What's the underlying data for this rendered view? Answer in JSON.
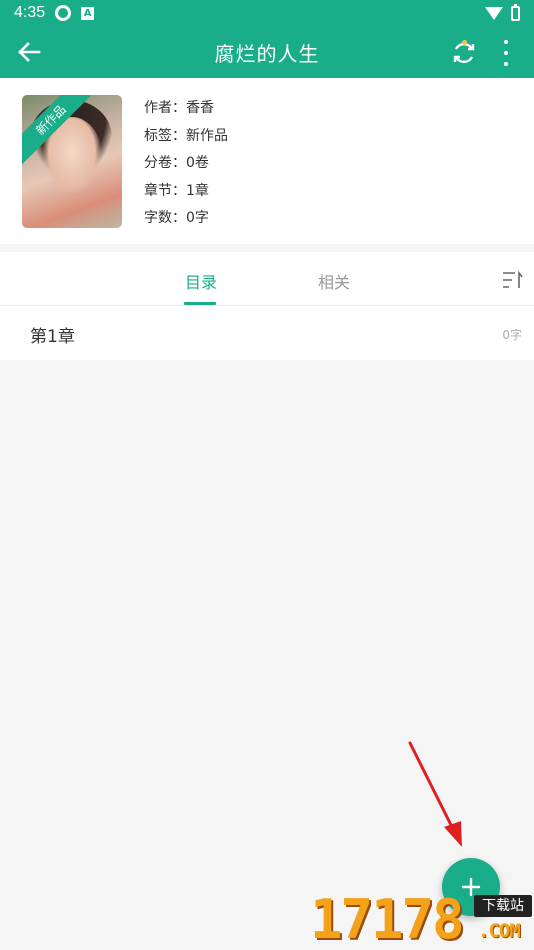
{
  "status_bar": {
    "time": "4:35",
    "a_icon_text": "A",
    "icons": [
      "gear-icon",
      "app-a-icon",
      "wifi-icon",
      "battery-icon"
    ]
  },
  "toolbar": {
    "title": "腐烂的人生",
    "back_icon": "arrow-left-icon",
    "sync_icon": "sync-icon",
    "more_icon": "more-vert-icon"
  },
  "book": {
    "cover_badge": "新作品",
    "author": "作者：香香",
    "tag": "标签：新作品",
    "volumes": "分卷：0卷",
    "chapters": "章节：1章",
    "words": "字数：0字"
  },
  "tabs": {
    "toc": "目录",
    "related": "相关",
    "sort_icon": "sort-icon"
  },
  "chapters": [
    {
      "title": "第1章",
      "count": "0字"
    }
  ],
  "fab": {
    "icon": "plus-icon"
  },
  "watermark": {
    "digits": "17178",
    "badge": "下载站",
    "com": ".COM"
  },
  "colors": {
    "accent": "#1aad8a",
    "background": "#f5f5f5",
    "arrow": "#e02020",
    "watermark": "#f3a21a"
  }
}
